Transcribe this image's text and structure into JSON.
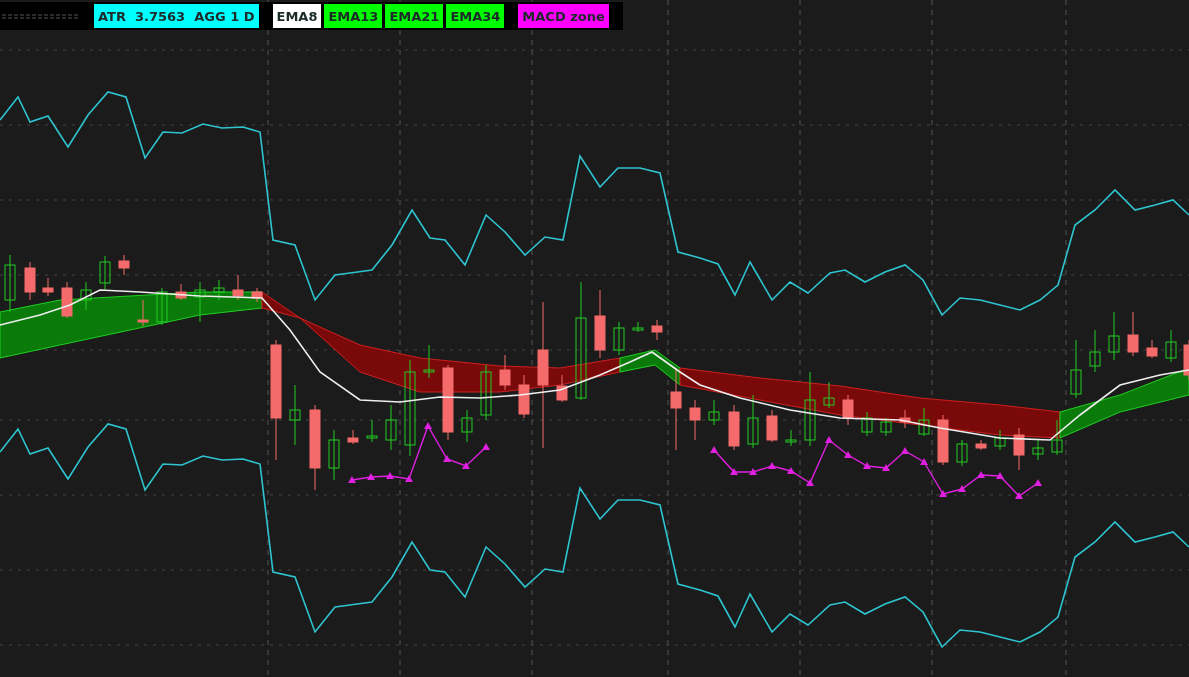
{
  "legend_groups": [
    {
      "items": [
        {
          "label": "ATR  3.7563  AGG 1 D",
          "color": "#00ffff"
        }
      ]
    },
    {
      "items": [
        {
          "label": "EMA8",
          "color": "#ffffff"
        },
        {
          "label": "EMA13",
          "color": "#00ff00"
        },
        {
          "label": "EMA21",
          "color": "#00ff00"
        },
        {
          "label": "EMA34",
          "color": "#00ff00"
        }
      ]
    },
    {
      "items": [
        {
          "label": "MACD zone",
          "color": "#ff00ff"
        }
      ]
    }
  ]
}
